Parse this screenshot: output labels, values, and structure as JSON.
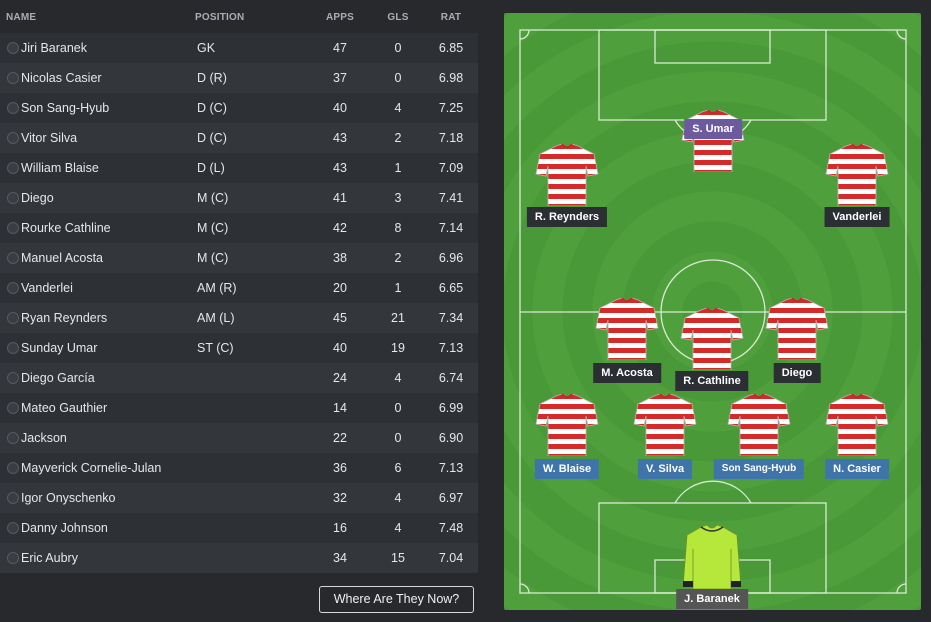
{
  "table": {
    "headers": {
      "name": "NAME",
      "position": "POSITION",
      "apps": "APPS",
      "gls": "GLS",
      "rat": "RAT"
    },
    "rows": [
      {
        "name": "Jiri Baranek",
        "position": "GK",
        "apps": "47",
        "gls": "0",
        "rat": "6.85"
      },
      {
        "name": "Nicolas Casier",
        "position": "D (R)",
        "apps": "37",
        "gls": "0",
        "rat": "6.98"
      },
      {
        "name": "Son Sang-Hyub",
        "position": "D (C)",
        "apps": "40",
        "gls": "4",
        "rat": "7.25"
      },
      {
        "name": "Vitor Silva",
        "position": "D (C)",
        "apps": "43",
        "gls": "2",
        "rat": "7.18"
      },
      {
        "name": "William Blaise",
        "position": "D (L)",
        "apps": "43",
        "gls": "1",
        "rat": "7.09"
      },
      {
        "name": "Diego",
        "position": "M (C)",
        "apps": "41",
        "gls": "3",
        "rat": "7.41"
      },
      {
        "name": "Rourke Cathline",
        "position": "M (C)",
        "apps": "42",
        "gls": "8",
        "rat": "7.14"
      },
      {
        "name": "Manuel Acosta",
        "position": "M (C)",
        "apps": "38",
        "gls": "2",
        "rat": "6.96"
      },
      {
        "name": "Vanderlei",
        "position": "AM (R)",
        "apps": "20",
        "gls": "1",
        "rat": "6.65"
      },
      {
        "name": "Ryan Reynders",
        "position": "AM (L)",
        "apps": "45",
        "gls": "21",
        "rat": "7.34"
      },
      {
        "name": "Sunday Umar",
        "position": "ST (C)",
        "apps": "40",
        "gls": "19",
        "rat": "7.13"
      },
      {
        "name": "Diego García",
        "position": "",
        "apps": "24",
        "gls": "4",
        "rat": "6.74"
      },
      {
        "name": "Mateo Gauthier",
        "position": "",
        "apps": "14",
        "gls": "0",
        "rat": "6.99"
      },
      {
        "name": "Jackson",
        "position": "",
        "apps": "22",
        "gls": "0",
        "rat": "6.90"
      },
      {
        "name": "Mayverick Cornelie-Julan",
        "position": "",
        "apps": "36",
        "gls": "6",
        "rat": "7.13"
      },
      {
        "name": "Igor Onyschenko",
        "position": "",
        "apps": "32",
        "gls": "4",
        "rat": "6.97"
      },
      {
        "name": "Danny Johnson",
        "position": "",
        "apps": "16",
        "gls": "4",
        "rat": "7.48"
      },
      {
        "name": "Eric Aubry",
        "position": "",
        "apps": "34",
        "gls": "15",
        "rat": "7.04"
      }
    ]
  },
  "where_button_label": "Where Are They Now?",
  "pitch": {
    "colors": {
      "grass_dark": "#4a9938",
      "grass_light": "#4fa03c",
      "line": "#e7f2e2",
      "shirt_red": "#d42a2a",
      "shirt_white": "#ffffff",
      "gk_shirt": "#b5e83a"
    },
    "players": [
      {
        "label": "S. Umar",
        "style": "purple",
        "kit": "outfield"
      },
      {
        "label": "R. Reynders",
        "style": "dark",
        "kit": "outfield"
      },
      {
        "label": "Vanderlei",
        "style": "dark",
        "kit": "outfield"
      },
      {
        "label": "M. Acosta",
        "style": "dark",
        "kit": "outfield"
      },
      {
        "label": "R. Cathline",
        "style": "dark",
        "kit": "outfield"
      },
      {
        "label": "Diego",
        "style": "dark",
        "kit": "outfield"
      },
      {
        "label": "W. Blaise",
        "style": "blue",
        "kit": "outfield"
      },
      {
        "label": "V. Silva",
        "style": "blue",
        "kit": "outfield"
      },
      {
        "label": "Son Sang-Hyub",
        "style": "blue",
        "kit": "outfield"
      },
      {
        "label": "N. Casier",
        "style": "blue",
        "kit": "outfield"
      },
      {
        "label": "J. Baranek",
        "style": "gk",
        "kit": "goalkeeper"
      }
    ]
  }
}
